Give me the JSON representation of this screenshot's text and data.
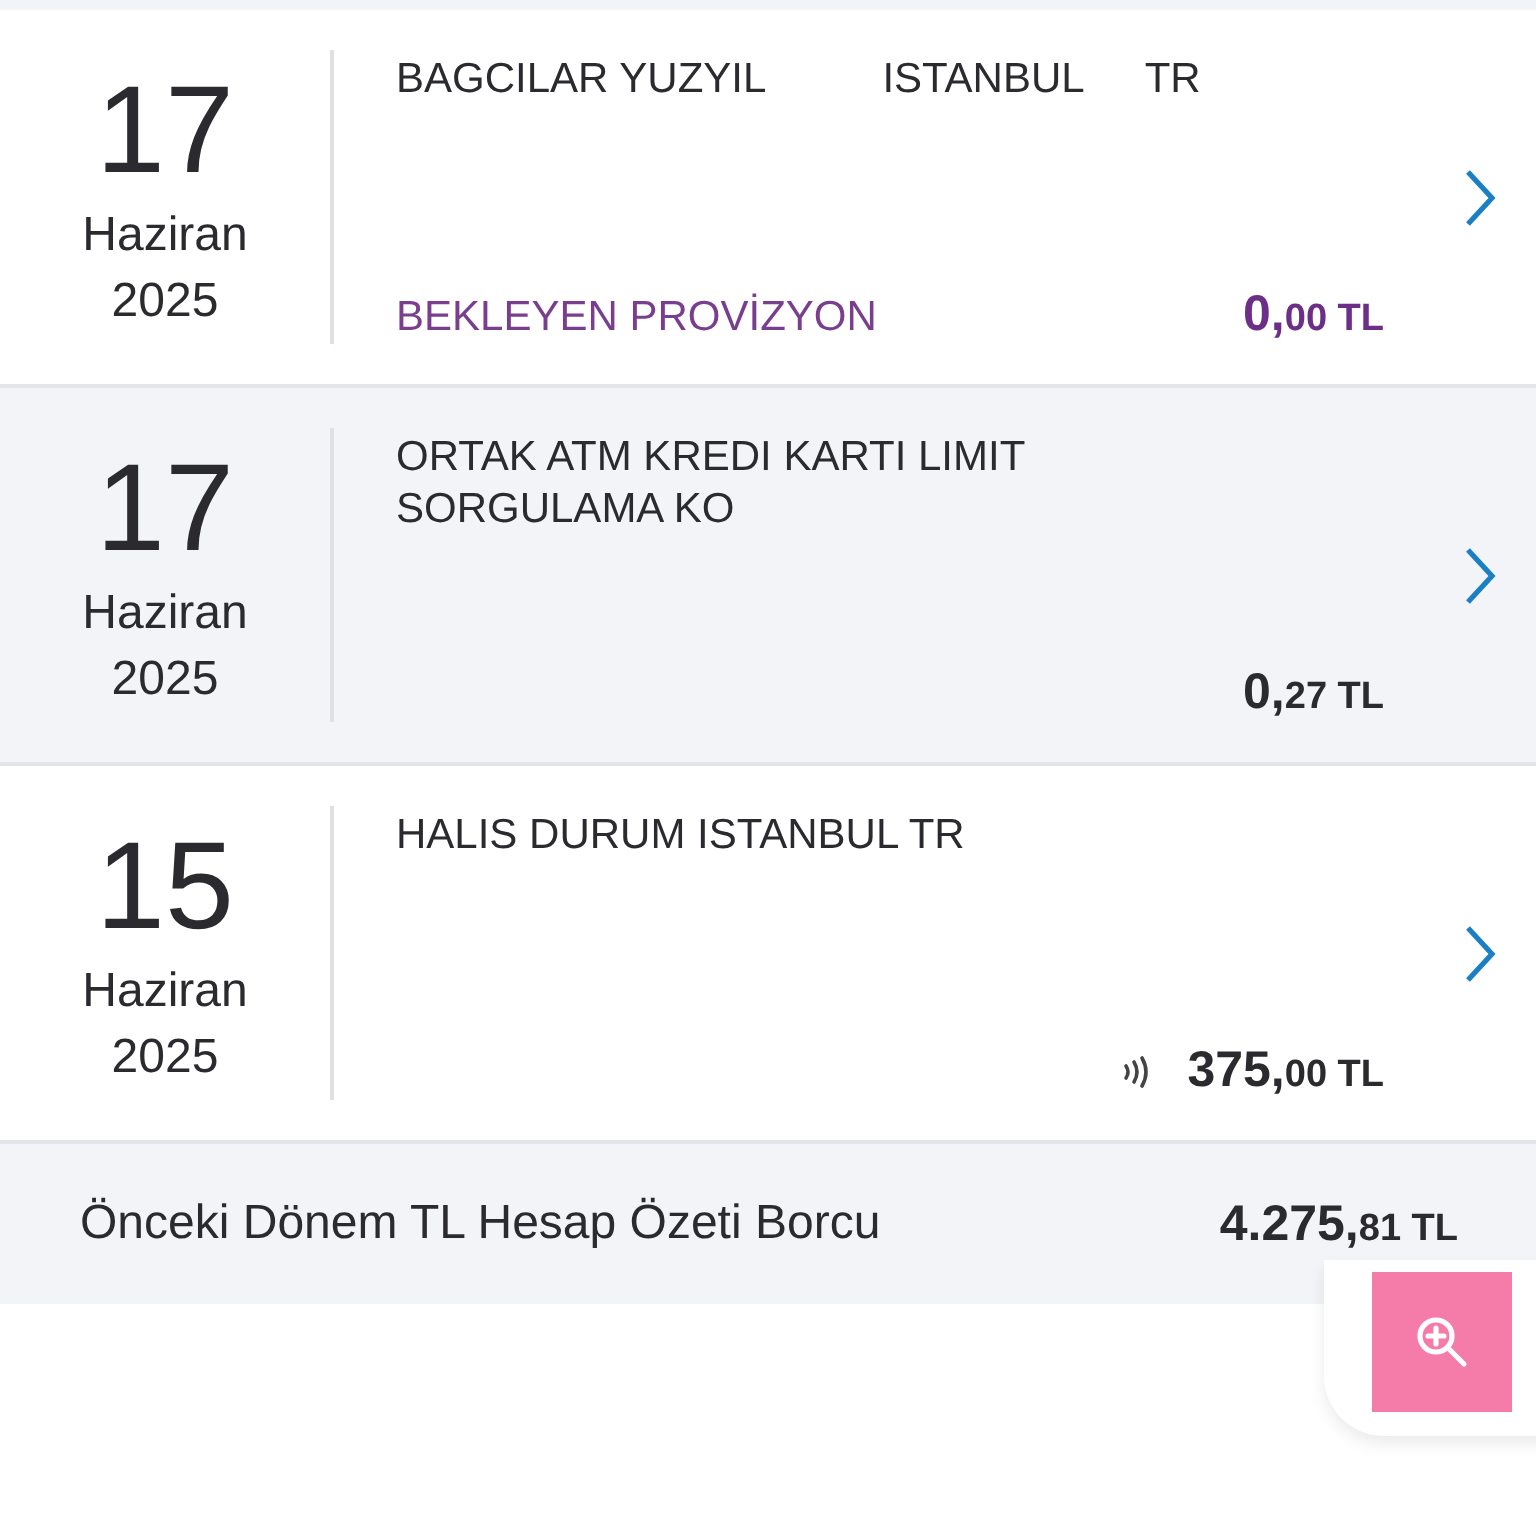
{
  "transactions": [
    {
      "day": "17",
      "month": "Haziran",
      "year": "2025",
      "merchant": [
        "BAGCILAR YUZYIL",
        "ISTANBUL",
        "TR"
      ],
      "status": "BEKLEYEN PROVİZYON",
      "pending": true,
      "contactless": false,
      "amount": "0,00 TL",
      "selected": false
    },
    {
      "day": "17",
      "month": "Haziran",
      "year": "2025",
      "merchant": [
        "ORTAK ATM KREDI KARTI LIMIT SORGULAMA KO"
      ],
      "pending": false,
      "contactless": false,
      "amount": "0,27 TL",
      "selected": true
    },
    {
      "day": "15",
      "month": "Haziran",
      "year": "2025",
      "merchant": [
        "HALIS DURUM ISTANBUL TR"
      ],
      "pending": false,
      "contactless": true,
      "amount": "375,00 TL",
      "selected": false
    }
  ],
  "summary": {
    "label": "Önceki Dönem TL Hesap Özeti Borcu",
    "amount": "4.275,81 TL"
  }
}
